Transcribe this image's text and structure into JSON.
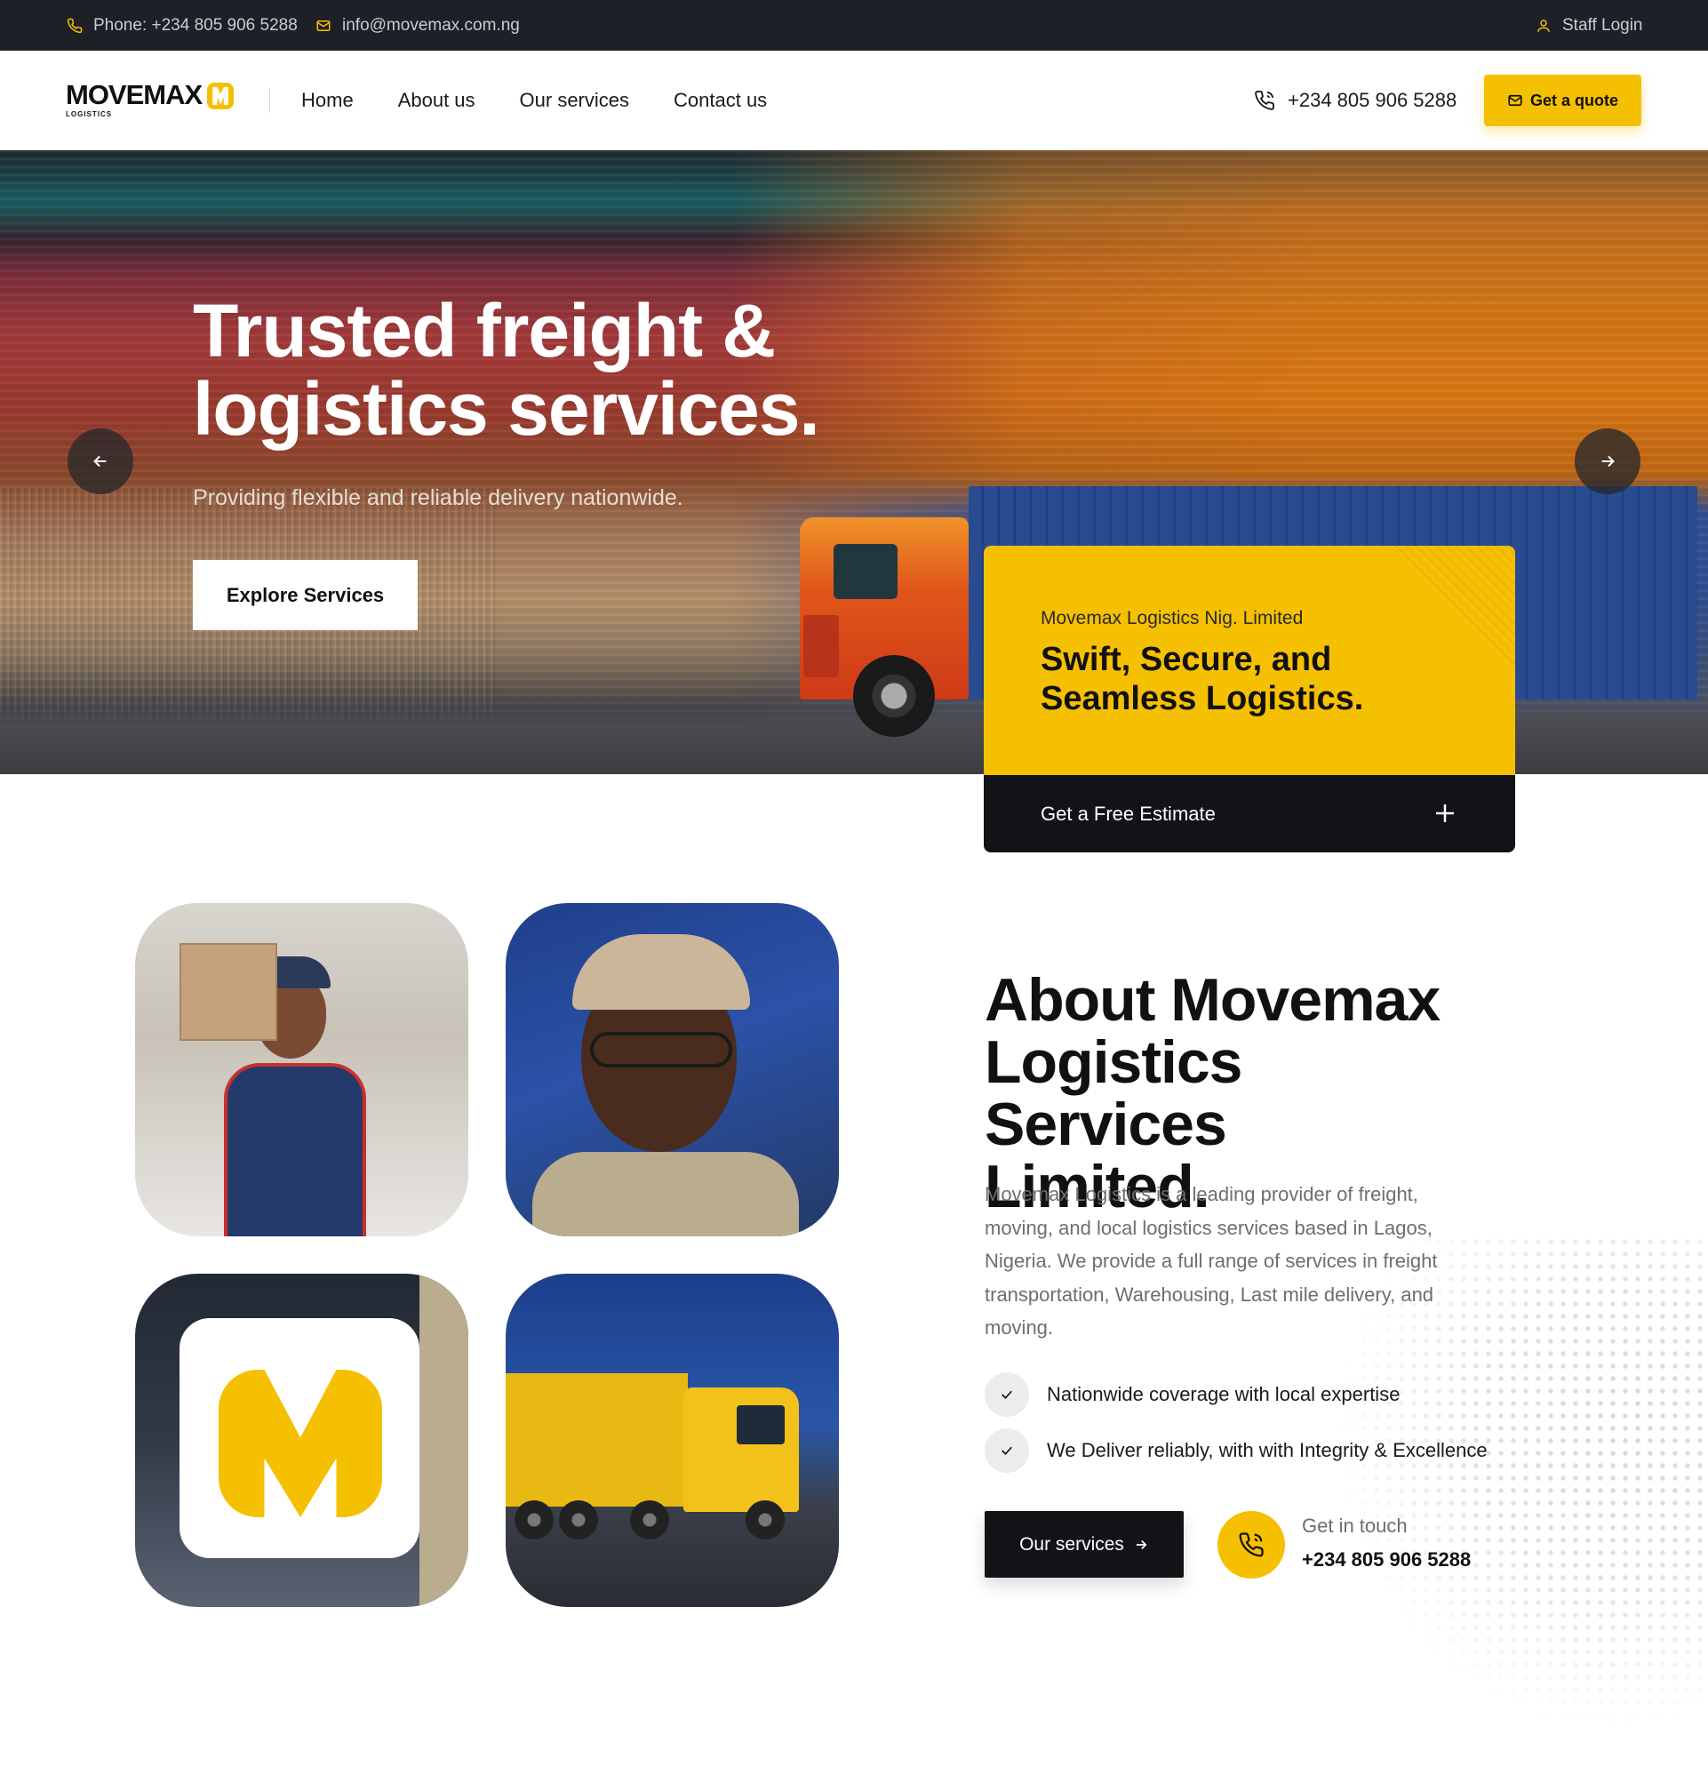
{
  "topbar": {
    "phone": "Phone: +234 805 906 5288",
    "email": "info@movemax.com.ng",
    "staff_login": "Staff Login",
    "icons": [
      "phone-icon",
      "mail-icon",
      "user-icon"
    ]
  },
  "header": {
    "logo_text": "MOVEMAX",
    "logo_sub": "LOGISTICS",
    "nav": [
      "Home",
      "About us",
      "Our services",
      "Contact us"
    ],
    "phone": "+234 805 906 5288",
    "quote_label": "Get a quote"
  },
  "hero": {
    "title_line1": "Trusted freight &",
    "title_line2": "logistics services.",
    "subtitle": "Providing flexible and reliable delivery nationwide.",
    "cta": "Explore Services",
    "prev_icon": "arrow-left-icon",
    "next_icon": "arrow-right-icon"
  },
  "promo_card": {
    "company": "Movemax Logistics Nig. Limited",
    "title_line1": "Swift, Secure, and",
    "title_line2": "Seamless Logistics.",
    "estimate_label": "Get a Free Estimate",
    "estimate_icon": "plus-icon"
  },
  "about": {
    "title_line1": "About Movemax",
    "title_line2": "Logistics Services",
    "title_line3": "Limited.",
    "description": "Movemax Logistics is a leading provider of freight, moving, and local logistics services based in Lagos, Nigeria. We provide a full range of services in freight transportation, Warehousing, Last mile delivery, and moving.",
    "checks": [
      "Nationwide coverage with local expertise",
      "We Deliver reliably, with with Integrity & Excellence"
    ],
    "services_button": "Our services",
    "contact_label": "Get in touch",
    "contact_phone": "+234 805 906 5288"
  },
  "colors": {
    "brand_yellow": "#f6c002",
    "dark": "#111317",
    "topbar": "#1d2127",
    "muted_text": "#6b6e75"
  }
}
